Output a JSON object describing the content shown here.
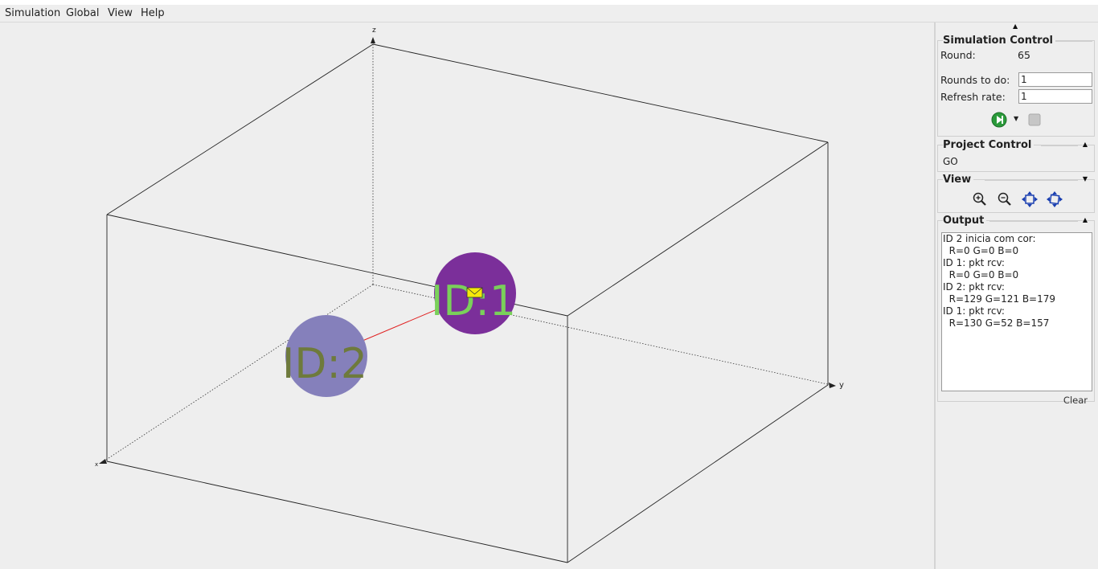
{
  "menubar": {
    "items": [
      "Simulation",
      "Global",
      "View",
      "Help"
    ]
  },
  "canvas": {
    "axes": {
      "z": "z",
      "y": "y",
      "x": "x"
    },
    "nodes": [
      {
        "label": "ID:2",
        "fill": "#8580bb",
        "text_color": "#6e7a3c"
      },
      {
        "label": "ID:1",
        "fill": "#7b2f9a",
        "text_color": "#7ad05a"
      }
    ],
    "edge_color": "#e02020",
    "message_icon": "envelope-icon"
  },
  "side": {
    "simulation_control": {
      "title": "Simulation Control",
      "round_label": "Round:",
      "round_value": "65",
      "rounds_to_do_label": "Rounds to do:",
      "rounds_to_do_value": "1",
      "refresh_rate_label": "Refresh rate:",
      "refresh_rate_value": "1",
      "run_icon": "play-icon",
      "dropdown_icon": "chevron-down-icon",
      "stop_icon": "stop-icon"
    },
    "project_control": {
      "title": "Project Control",
      "button_label": "GO"
    },
    "view": {
      "title": "View",
      "icons": [
        "zoom-in-icon",
        "zoom-out-icon",
        "zoom-fit-icon",
        "zoom-rotate-icon"
      ]
    },
    "output": {
      "title": "Output",
      "lines": [
        "ID 2 inicia com cor:",
        "  R=0 G=0 B=0",
        "ID 1: pkt rcv:",
        "  R=0 G=0 B=0",
        "ID 2: pkt rcv:",
        "  R=129 G=121 B=179",
        "ID 1: pkt rcv:",
        "  R=130 G=52 B=157"
      ],
      "clear_label": "Clear"
    }
  }
}
